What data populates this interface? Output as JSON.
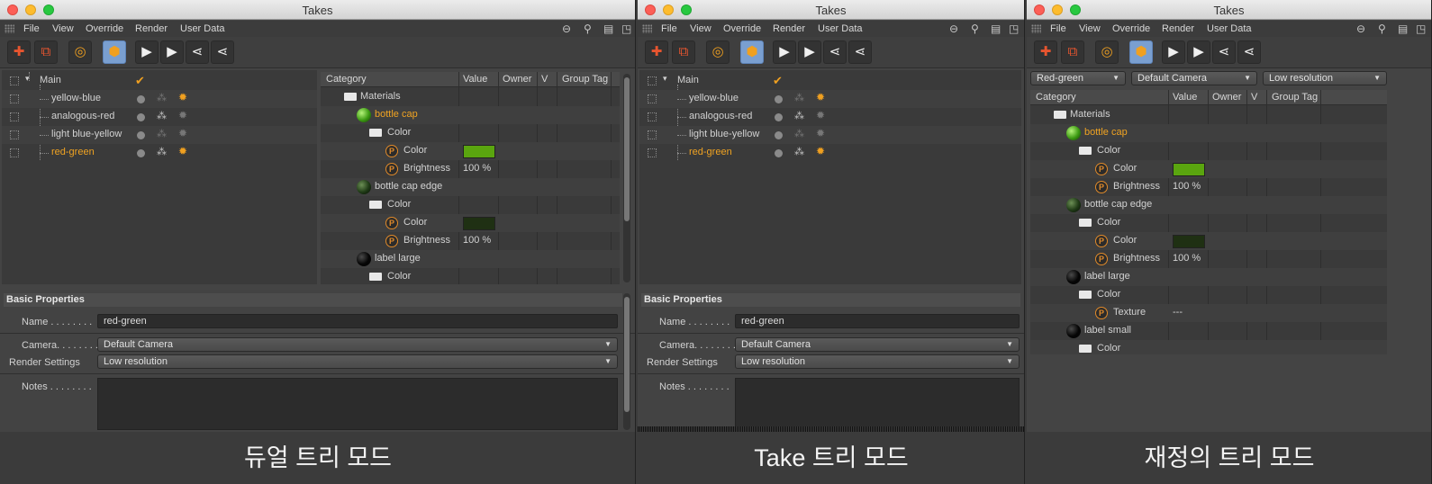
{
  "window_title": "Takes",
  "menu": [
    "File",
    "View",
    "Override",
    "Render",
    "User Data"
  ],
  "takes": [
    {
      "name": "Main",
      "state": "main"
    },
    {
      "name": "yellow-blue",
      "state": "normal"
    },
    {
      "name": "analogous-red",
      "state": "normal"
    },
    {
      "name": "light blue-yellow",
      "state": "normal"
    },
    {
      "name": "red-green",
      "state": "selected"
    }
  ],
  "columns": [
    "Category",
    "Value",
    "Owner",
    "V",
    "Group Tag"
  ],
  "overrides": {
    "materials": "Materials",
    "bottle_cap": "bottle cap",
    "bottle_cap_edge": "bottle cap edge",
    "label_large": "label large",
    "label_small": "label small",
    "color_group": "Color",
    "color": "Color",
    "brightness": "Brightness",
    "texture": "Texture",
    "brightness_value": "100 %",
    "texture_value": "---",
    "bottle_cap_color": "#5aa50f",
    "edge_color": "#1f3013"
  },
  "attributes": {
    "section": "Basic Properties",
    "name_label": "Name . . . . . . . .",
    "name_value": "red-green",
    "camera_label": "Camera. . . . . . . .",
    "camera_value": "Default Camera",
    "render_label": "Render Settings",
    "render_value": "Low resolution",
    "notes_label": "Notes . . . . . . . ."
  },
  "filters": {
    "take": "Red-green",
    "camera": "Default Camera",
    "render": "Low resolution"
  },
  "captions": {
    "dual": "듀얼 트리 모드",
    "take": "Take 트리 모드",
    "override": "재정의 트리 모드"
  }
}
